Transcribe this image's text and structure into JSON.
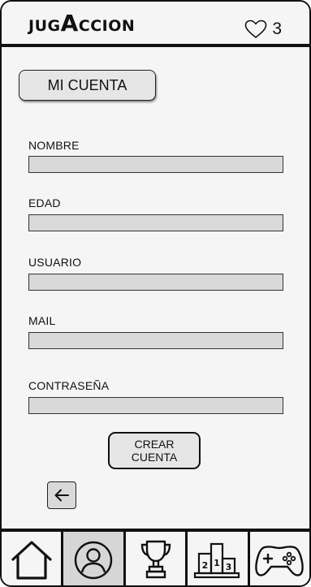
{
  "header": {
    "logo_part1": "JUG",
    "logo_part2": "A",
    "logo_part3": "CCION",
    "likes_count": "3",
    "like_icon": "heart-icon"
  },
  "account_button_label": "MI CUENTA",
  "form": {
    "fields": [
      {
        "label": "NOMBRE",
        "value": ""
      },
      {
        "label": "EDAD",
        "value": ""
      },
      {
        "label": "USUARIO",
        "value": ""
      },
      {
        "label": "MAIL",
        "value": ""
      },
      {
        "label": "CONTRASEÑA",
        "value": ""
      }
    ],
    "submit_line1": "CREAR",
    "submit_line2": "CUENTA"
  },
  "back_icon": "arrow-left-icon",
  "nav": {
    "items": [
      {
        "icon": "home-icon",
        "active": false
      },
      {
        "icon": "user-icon",
        "active": true
      },
      {
        "icon": "trophy-icon",
        "active": false
      },
      {
        "icon": "podium-icon",
        "active": false
      },
      {
        "icon": "gamepad-icon",
        "active": false
      }
    ],
    "podium_labels": [
      "2",
      "1",
      "3"
    ]
  },
  "colors": {
    "background": "#f5f5f5",
    "input_fill": "#d9d9d9",
    "active_nav": "#d6d6d6",
    "border": "#111111"
  }
}
